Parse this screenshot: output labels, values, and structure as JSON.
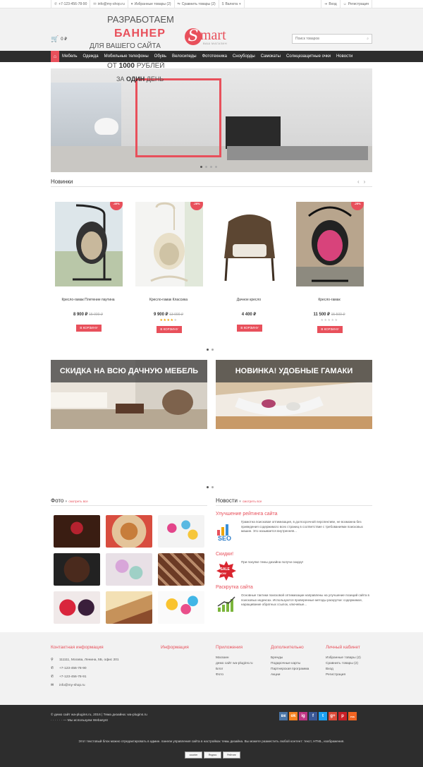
{
  "topbar": {
    "phone": "+7-123-456-78-90",
    "email": "info@my-shop.ru",
    "favorites": "Избранные товары (2)",
    "compare": "Сравнить товары (2)",
    "currency": "Валюта",
    "login": "Вход",
    "register": "Регистрация"
  },
  "header": {
    "cart_total": "0 ₽",
    "logo_letter": "S",
    "logo_text": "mart",
    "logo_subtitle": "ВАШ МАГАЗИН",
    "search_placeholder": "Поиск товаров"
  },
  "nav": {
    "items": [
      "Мебель",
      "Одежда",
      "Мобильные телефоны",
      "Обувь",
      "Велосипеды",
      "Фототехника",
      "Сноуборды",
      "Самокаты",
      "Солнцезащитные очки",
      "Новости"
    ]
  },
  "banner": {
    "line1": "РАЗРАБОТАЕМ",
    "line2": "БАННЕР",
    "line3": "ДЛЯ ВАШЕГО САЙТА",
    "line4_pre": "ОТ ",
    "line4_bold": "1000",
    "line4_post": " РУБЛЕЙ",
    "line5_pre": "ЗА ",
    "line5_bold": "ОДИН",
    "line5_post": " ДЕНЬ"
  },
  "new_section": {
    "title": "Новинки",
    "products": [
      {
        "name": "Кресло-гамак Плетение паутина",
        "price": "8 900 ₽",
        "old_price": "15 000 ₽",
        "badge": "-40%",
        "button": "В КОРЗИНУ",
        "rating": 0
      },
      {
        "name": "Кресло-гамак Классика",
        "price": "9 900 ₽",
        "old_price": "13 900 ₽",
        "badge": "-28%",
        "button": "В КОРЗИНУ",
        "rating": 4
      },
      {
        "name": "Дачное кресло",
        "price": "4 400 ₽",
        "old_price": "",
        "badge": "",
        "button": "В КОРЗИНУ",
        "rating": 0
      },
      {
        "name": "Кресло-гамак",
        "price": "11 500 ₽",
        "old_price": "15 500 ₽",
        "badge": "-25%",
        "button": "В КОРЗИНУ",
        "rating": 0
      }
    ]
  },
  "promos": {
    "left": "СКИДКА НА ВСЮ ДАЧНУЮ МЕБЕЛЬ",
    "right": "НОВИНКА! УДОБНЫЕ ГАМАКИ"
  },
  "photo": {
    "title": "Фото",
    "see_all": "смотреть все"
  },
  "news": {
    "title": "Новости",
    "see_all": "смотреть все",
    "items": [
      {
        "title": "Улучшение рейтинга сайта",
        "text": "Грамотна поисковая оптимизация, в долгосрочной перспективе, не возможна без приведения содержимого всех страниц в соответствие с требованиями поисковых машин. Это называется внутренняя..."
      },
      {
        "title": "Скидки!",
        "text": "При покупке темы дизайна получи скидку!"
      },
      {
        "title": "Раскрутка сайта",
        "text": "Основные тактики поисковой оптимизации направлены на улучшение позиций сайта в поисковых индексах. Используются проверенные методы раскрутки: содержимое, наращивание обратных ссылок, ключевые..."
      }
    ]
  },
  "footer": {
    "contact": {
      "title": "Контактная информация",
      "address": "111111, Москва, Ленина, 5Б, офис 201",
      "phone1": "+7-123-456-78-90",
      "phone2": "+7-123-456-78-91",
      "email": "info@my-shop.ru"
    },
    "info": {
      "title": "Информация"
    },
    "apps": {
      "title": "Приложения",
      "links": [
        "Магазин",
        "демо сайт wa-plugins.ru",
        "Блог",
        "Фото"
      ]
    },
    "extra": {
      "title": "Дополнительно",
      "links": [
        "Бренды",
        "Подарочные карты",
        "Партнерская программа",
        "Акции"
      ]
    },
    "account": {
      "title": "Личный кабинет",
      "links": [
        "Избранные товары (2)",
        "Сравнить товары (2)",
        "Вход",
        "Регистрация"
      ]
    }
  },
  "bottom": {
    "copyright": "© демо сайт wa-plugins.ru, 2016 | Тема дизайна: wa-plugins.ru",
    "powered": "· · · · · · — Мы используем Webasyst",
    "note": "Этот текстовый блок можно отредактировать в админ. панели управления сайта в настройках темы дизайна. Вы можете разместить любой контент: текст, HTML, изображения.",
    "socials": [
      "вк",
      "ok",
      "ig",
      "f",
      "t",
      "g+",
      "p",
      "rss"
    ],
    "counters": [
      "counter",
      "Яндекс",
      "Рейтинг"
    ]
  }
}
